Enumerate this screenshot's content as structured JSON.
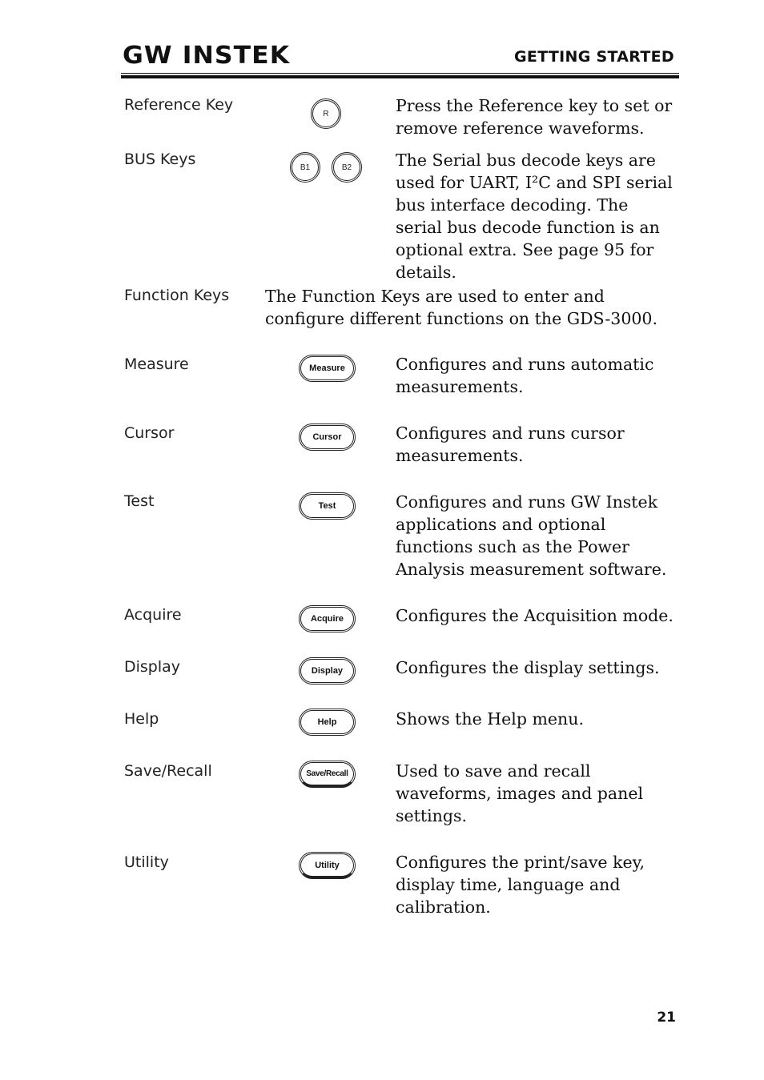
{
  "header": {
    "logo": "GW INSTEK",
    "section": "GETTING STARTED"
  },
  "rows": [
    {
      "label": "Reference Key",
      "keys": [
        "R"
      ],
      "desc": "Press the Reference key to set or remove reference waveforms."
    },
    {
      "label": "BUS Keys",
      "keys": [
        "B1",
        "B2"
      ],
      "desc": "The Serial bus decode keys are used for UART, I²C and SPI serial bus interface decoding. The serial bus decode function is an optional extra. See page 95 for details."
    },
    {
      "label": "Function Keys",
      "desc": "The Function Keys are used to enter and configure different functions on the GDS-3000."
    },
    {
      "label": "Measure",
      "key": "Measure",
      "desc": "Configures and runs automatic measurements."
    },
    {
      "label": "Cursor",
      "key": "Cursor",
      "desc": "Configures and runs cursor measurements."
    },
    {
      "label": "Test",
      "key": "Test",
      "desc": "Configures and runs GW Instek applications and optional functions such as the Power Analysis measurement software."
    },
    {
      "label": "Acquire",
      "key": "Acquire",
      "desc": "Configures the Acquisition mode."
    },
    {
      "label": "Display",
      "key": "Display",
      "desc": "Configures the display settings."
    },
    {
      "label": "Help",
      "key": "Help",
      "desc": "Shows the Help menu."
    },
    {
      "label": "Save/Recall",
      "key": "Save/Recall",
      "desc": "Used to save and recall waveforms, images and panel settings."
    },
    {
      "label": "Utility",
      "key": "Utility",
      "desc": "Configures the print/save key, display time, language and calibration."
    }
  ],
  "footer": {
    "page_number": "21"
  }
}
